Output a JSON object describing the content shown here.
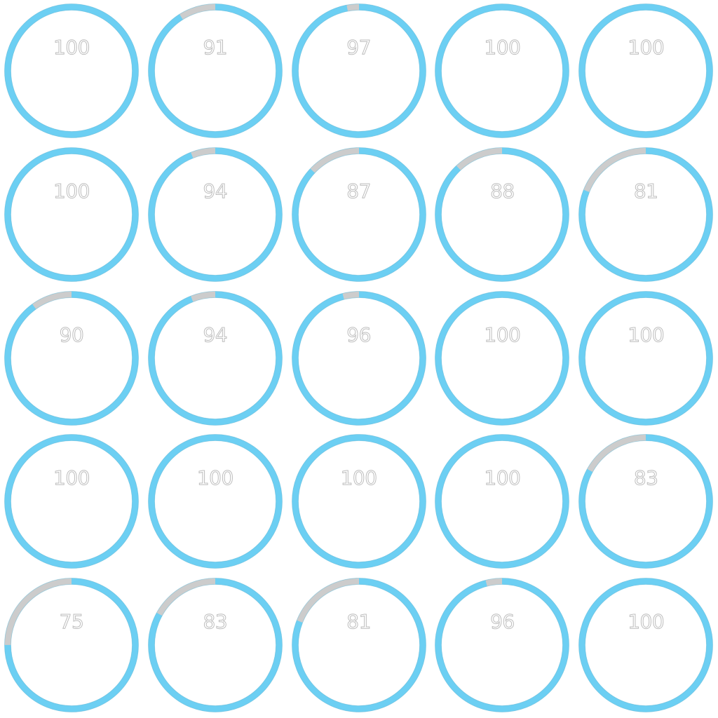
{
  "colors": {
    "progress": "#6ccff3",
    "track": "#cccccc",
    "text_outline": "#bdbdbd"
  },
  "chart_data": {
    "type": "radial-progress-grid",
    "rows": 5,
    "columns": 5,
    "max": 100,
    "values": [
      [
        100,
        91,
        97,
        100,
        100
      ],
      [
        100,
        94,
        87,
        88,
        81
      ],
      [
        90,
        94,
        96,
        100,
        100
      ],
      [
        100,
        100,
        100,
        100,
        83
      ],
      [
        75,
        83,
        81,
        96,
        100
      ]
    ]
  }
}
